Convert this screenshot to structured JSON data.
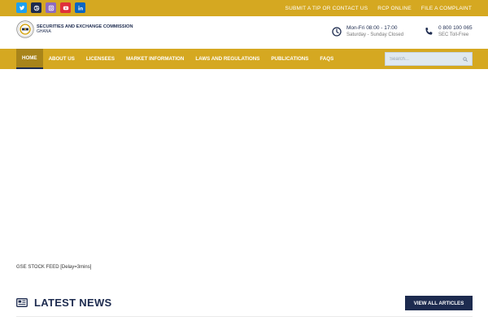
{
  "colors": {
    "gold": "#d5a821",
    "gold_dark": "#a8841a",
    "navy": "#1d2b4f",
    "twitter": "#1da1f2",
    "dribbble": "#1d2b4f",
    "instagram": "#8e6bbf",
    "youtube": "#e0303a",
    "linkedin": "#0a66c2"
  },
  "topbar": {
    "social": [
      {
        "name": "twitter-icon"
      },
      {
        "name": "dribbble-icon"
      },
      {
        "name": "instagram-icon"
      },
      {
        "name": "youtube-icon"
      },
      {
        "name": "linkedin-icon"
      }
    ],
    "links": [
      {
        "label": "SUBMIT A TIP OR CONTACT US"
      },
      {
        "label": "RCP ONLINE"
      },
      {
        "label": "FILE A COMPLAINT"
      }
    ]
  },
  "header": {
    "logo_title": "SECURITIES AND EXCHANGE COMMISSION",
    "logo_sub": "GHANA",
    "hours": {
      "main": "Mon-Fri 08:00 - 17:00",
      "sub": "Saturday - Sunday Closed",
      "icon": "clock-icon"
    },
    "phone": {
      "main": "0 800 100 065",
      "sub": "SEC Toll-Free",
      "icon": "phone-icon"
    }
  },
  "nav": {
    "items": [
      {
        "label": "HOME",
        "active": true
      },
      {
        "label": "ABOUT US"
      },
      {
        "label": "LICENSEES"
      },
      {
        "label": "MARKET INFORMATION"
      },
      {
        "label": "LAWS AND REGULATIONS"
      },
      {
        "label": "PUBLICATIONS"
      },
      {
        "label": "FAQS"
      }
    ],
    "search": {
      "placeholder": "Search...",
      "value": "",
      "icon": "search-icon"
    }
  },
  "content": {
    "feed_label": "GSE STOCK FEED [Delay=3mins]",
    "news_title": "LATEST NEWS",
    "news_icon": "newspaper-icon",
    "view_all_label": "VIEW ALL ARTICLES"
  }
}
